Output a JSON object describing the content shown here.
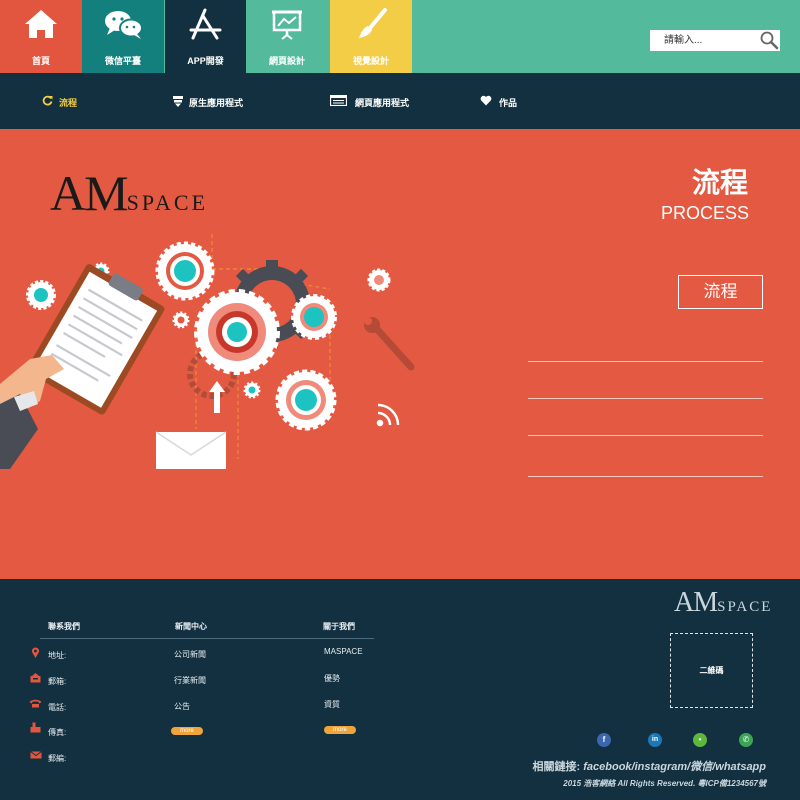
{
  "topnav": {
    "tabs": [
      {
        "label": "首頁",
        "icon": "home-icon",
        "color": "#e2553f"
      },
      {
        "label": "微信平臺",
        "icon": "wechat-icon",
        "color": "#14807d"
      },
      {
        "label": "APP開發",
        "icon": "app-store-icon",
        "color": "#12303f"
      },
      {
        "label": "網頁設計",
        "icon": "presentation-board-icon",
        "color": "#53bb9c"
      },
      {
        "label": "視覺設計",
        "icon": "paintbrush-icon",
        "color": "#f3cd45"
      }
    ],
    "search": {
      "placeholder": "請輸入...",
      "icon": "search-icon"
    }
  },
  "subnav": {
    "items": [
      {
        "label": "流程",
        "icon": "refresh-icon",
        "active": true
      },
      {
        "label": "原生應用程式",
        "icon": "layers-icon"
      },
      {
        "label": "網頁應用程式",
        "icon": "browser-window-icon"
      },
      {
        "label": "作品",
        "icon": "heart-icon"
      }
    ]
  },
  "hero": {
    "logo": {
      "big": "AM",
      "small": "SPACE"
    },
    "title": "流程",
    "subtitle": "PROCESS",
    "button": "流程",
    "background": "#e45941"
  },
  "footer": {
    "columns": [
      {
        "heading": "聯系我們",
        "items": [
          "地址:",
          "郵箱:",
          "電話:",
          "傳真:",
          "郵編:"
        ]
      },
      {
        "heading": "新聞中心",
        "items": [
          "公司新聞",
          "行業新聞",
          "公告"
        ],
        "more": "more"
      },
      {
        "heading": "關于我們",
        "items": [
          "MASPACE",
          "優勢",
          "資質"
        ],
        "more": "more"
      }
    ],
    "contact_icons": [
      "location-pin-icon",
      "mailbox-icon",
      "phone-icon",
      "fax-icon",
      "envelope-icon"
    ],
    "logo": {
      "big": "AM",
      "small": "SPACE"
    },
    "qr_label": "二維碼",
    "social": [
      {
        "name": "facebook-icon",
        "glyph": "f",
        "color": "#3b66b0"
      },
      {
        "name": "linkedin-icon",
        "glyph": "in",
        "color": "#1c78b7"
      },
      {
        "name": "wechat-social-icon",
        "glyph": "•",
        "color": "#5bb83c"
      },
      {
        "name": "whatsapp-icon",
        "glyph": "✆",
        "color": "#3aa655"
      }
    ],
    "links_prefix": "相關鏈接:",
    "links_text": "facebook/instagram/微信/whatsapp",
    "copyright": "2015 浩客網絡 All Rights Reserved. 粵ICP備1234567號"
  }
}
